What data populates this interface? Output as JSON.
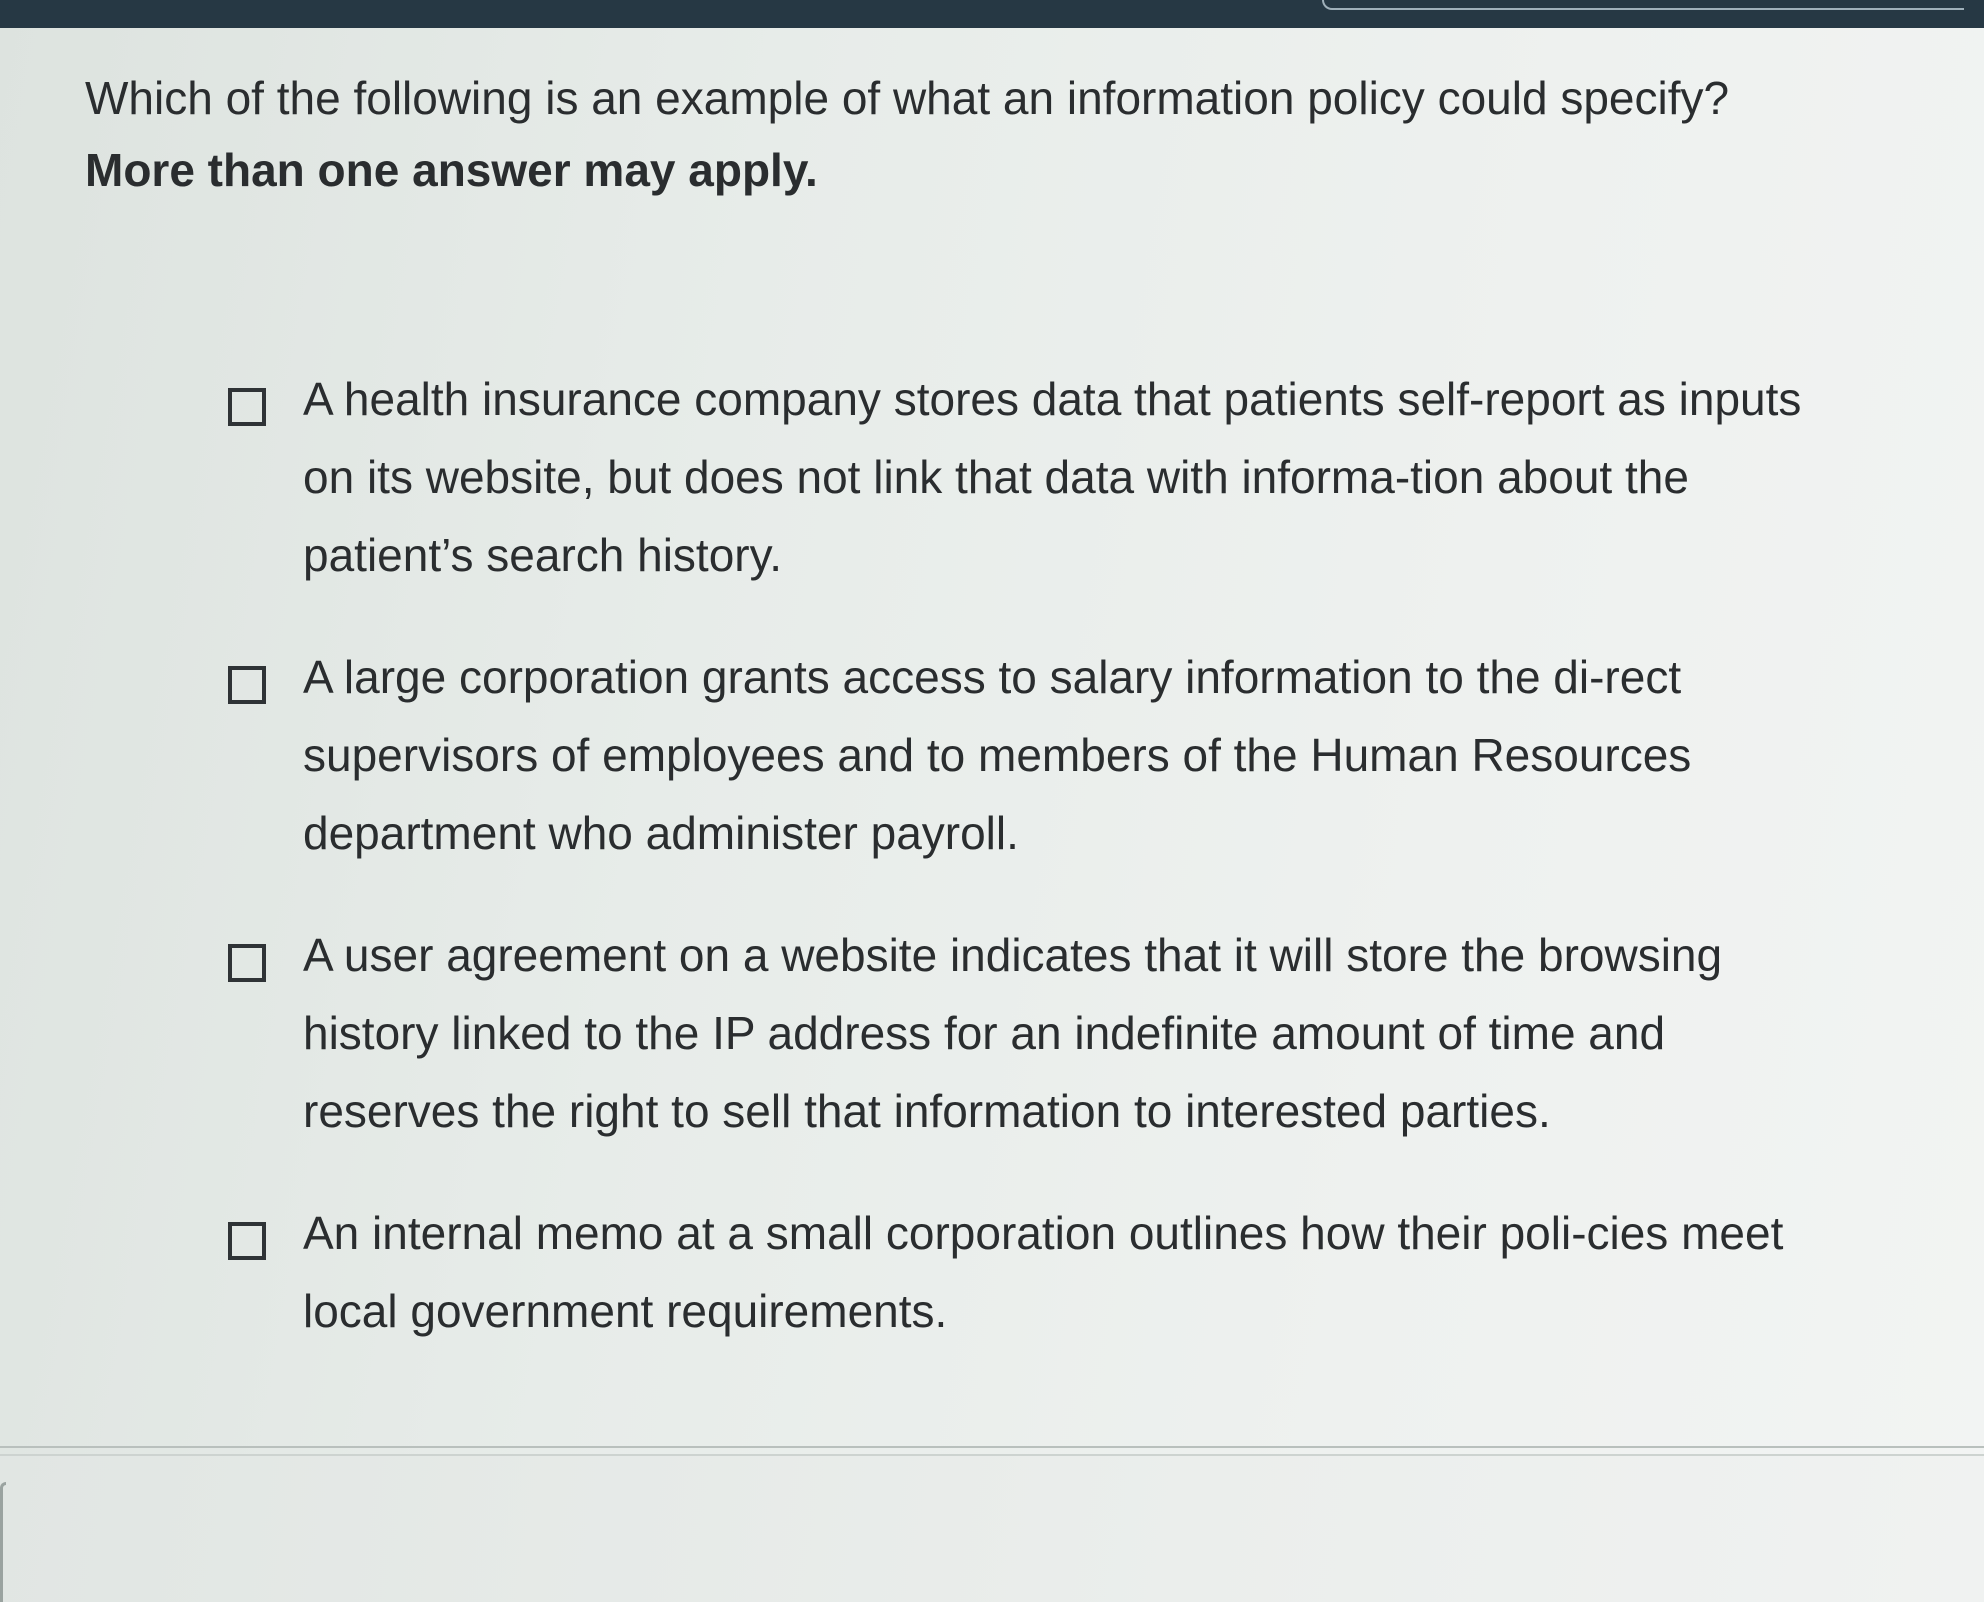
{
  "question": {
    "text": "Which of the following is an example of what an information policy could specify?",
    "emphasis": "More than one answer may apply."
  },
  "options": [
    {
      "label": "A health insurance company stores data that patients self-report as inputs on its website, but does not link that data with informa-tion about the patient’s search history.",
      "checked": false
    },
    {
      "label": "A large corporation grants access to salary information to the di-rect supervisors of employees and to members of the Human Resources department who administer payroll.",
      "checked": false
    },
    {
      "label": "A user agreement on a website indicates that it will store the browsing history linked to the IP address for an indefinite amount of time and reserves the right to sell that information to interested parties.",
      "checked": false
    },
    {
      "label": "An internal memo at a small corporation outlines how their poli-cies meet local government requirements.",
      "checked": false
    }
  ],
  "colors": {
    "top_bar": "#263844",
    "text": "#2a2d2f",
    "checkbox_border": "#2f3336"
  }
}
